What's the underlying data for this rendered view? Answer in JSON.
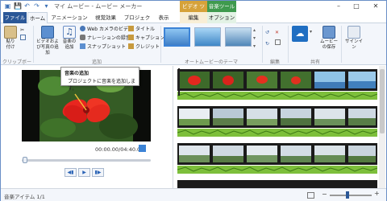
{
  "window": {
    "title": "マイ ムービー - ムービー メーカー",
    "context_video": "ビデオ ツール",
    "context_music": "音楽ツール"
  },
  "tabs": [
    "ファイル",
    "ホーム",
    "アニメーション",
    "視覚効果",
    "プロジェクト",
    "表示",
    "編集",
    "オプション"
  ],
  "ribbon": {
    "paste_label": "貼り付け",
    "add_media_label": "ビデオおよび写真の追加",
    "add_music_label": "音楽の追加",
    "webcam_label": "Web カメラのビデオ",
    "narration_label": "ナレーションの録音",
    "snapshot_label": "スナップショット",
    "title_label": "タイトル",
    "caption_label": "キャプション",
    "credit_label": "クレジット",
    "save_movie_label": "ムービーの保存",
    "signin_label": "サインイン",
    "groups": {
      "clipboard": "クリップボード",
      "add": "追加",
      "autotheme": "オートムービーのテーマ",
      "edit": "編集",
      "share": "共有"
    }
  },
  "tooltip": {
    "title": "音楽の追加",
    "body": "プロジェクトに音楽を追加します。"
  },
  "preview": {
    "time": "00:00.00/04:40.00"
  },
  "status": {
    "text": "音楽アイテム 1/1"
  },
  "colors": {
    "accent": "#2b5797",
    "video_context": "#d6a23a",
    "music_context": "#3f9a4e",
    "music_track": "#7dbf3b"
  }
}
